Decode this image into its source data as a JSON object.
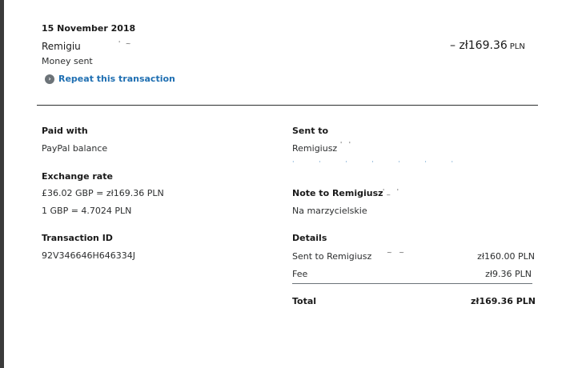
{
  "header": {
    "date": "15 November 2018",
    "recipient_name": "Remigiu",
    "recipient_mask": "' ~",
    "status": "Money sent",
    "repeat_label": "Repeat this transaction",
    "amount": "– zł169.36",
    "amount_currency": "PLN"
  },
  "left": {
    "paid_with_label": "Paid with",
    "paid_with_value": "PayPal balance",
    "exchange_label": "Exchange rate",
    "exchange_line1": "£36.02 GBP = zł169.36 PLN",
    "exchange_line2": "1 GBP = 4.7024 PLN",
    "txn_label": "Transaction ID",
    "txn_value": "92V346646H646334J"
  },
  "right": {
    "sent_to_label": "Sent to",
    "sent_to_name": "Remigiusz",
    "sent_to_mask": "' '",
    "note_label": "Note to Remigiusz",
    "note_mask": "'_  '",
    "note_value": "Na marzycielskie",
    "details_label": "Details",
    "details_rows": [
      {
        "label": "Sent to Remigiusz",
        "mask": "~ ~",
        "amount": "zł160.00 PLN"
      },
      {
        "label": "Fee",
        "mask": "",
        "amount": "zł9.36 PLN"
      }
    ],
    "total_label": "Total",
    "total_amount": "zł169.36 PLN"
  },
  "colors": {
    "link": "#1f6fb2",
    "text": "#2c2e2f",
    "icon_bg": "#6c7378"
  },
  "icons": {
    "repeat": "chevron-right-circle-icon"
  }
}
